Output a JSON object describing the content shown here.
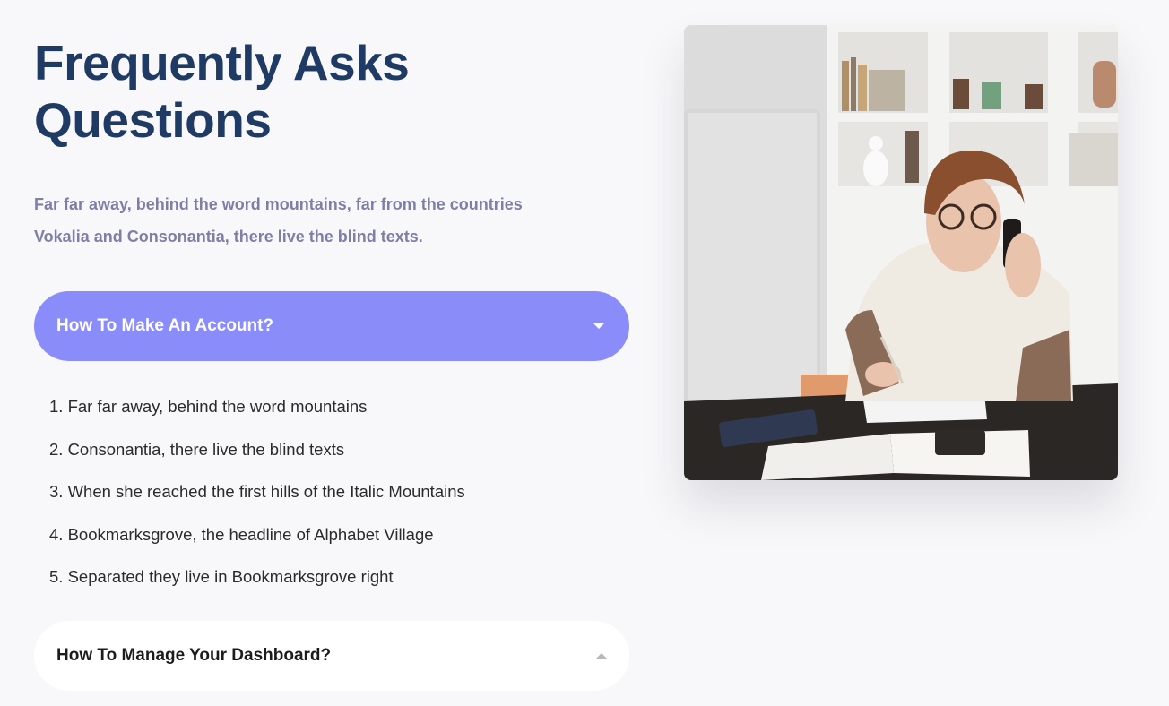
{
  "faq": {
    "title_line1": "Frequently Asks",
    "title_line2": "Questions",
    "intro_line1": "Far far away, behind the word mountains, far from the countries",
    "intro_line2": "Vokalia and Consonantia, there live the blind texts."
  },
  "accordion": {
    "open_item": {
      "label": "How To Make An Account?",
      "icon": "caret-down-icon",
      "answers": [
        "1. Far far away, behind the word mountains",
        "2. Consonantia, there live the blind texts",
        "3. When she reached the first hills of the Italic Mountains",
        "4. Bookmarksgrove, the headline of Alphabet Village",
        "5. Separated they live in Bookmarksgrove right"
      ]
    },
    "closed_item": {
      "label": "How To Manage Your Dashboard?",
      "icon": "caret-up-icon"
    }
  },
  "colors": {
    "title": "#1f3a63",
    "intro": "#7f7fa6",
    "accent": "#8a8cf9",
    "background": "#f8f8fa"
  },
  "image": {
    "subject": "woman-on-phone-at-desk-photo"
  }
}
